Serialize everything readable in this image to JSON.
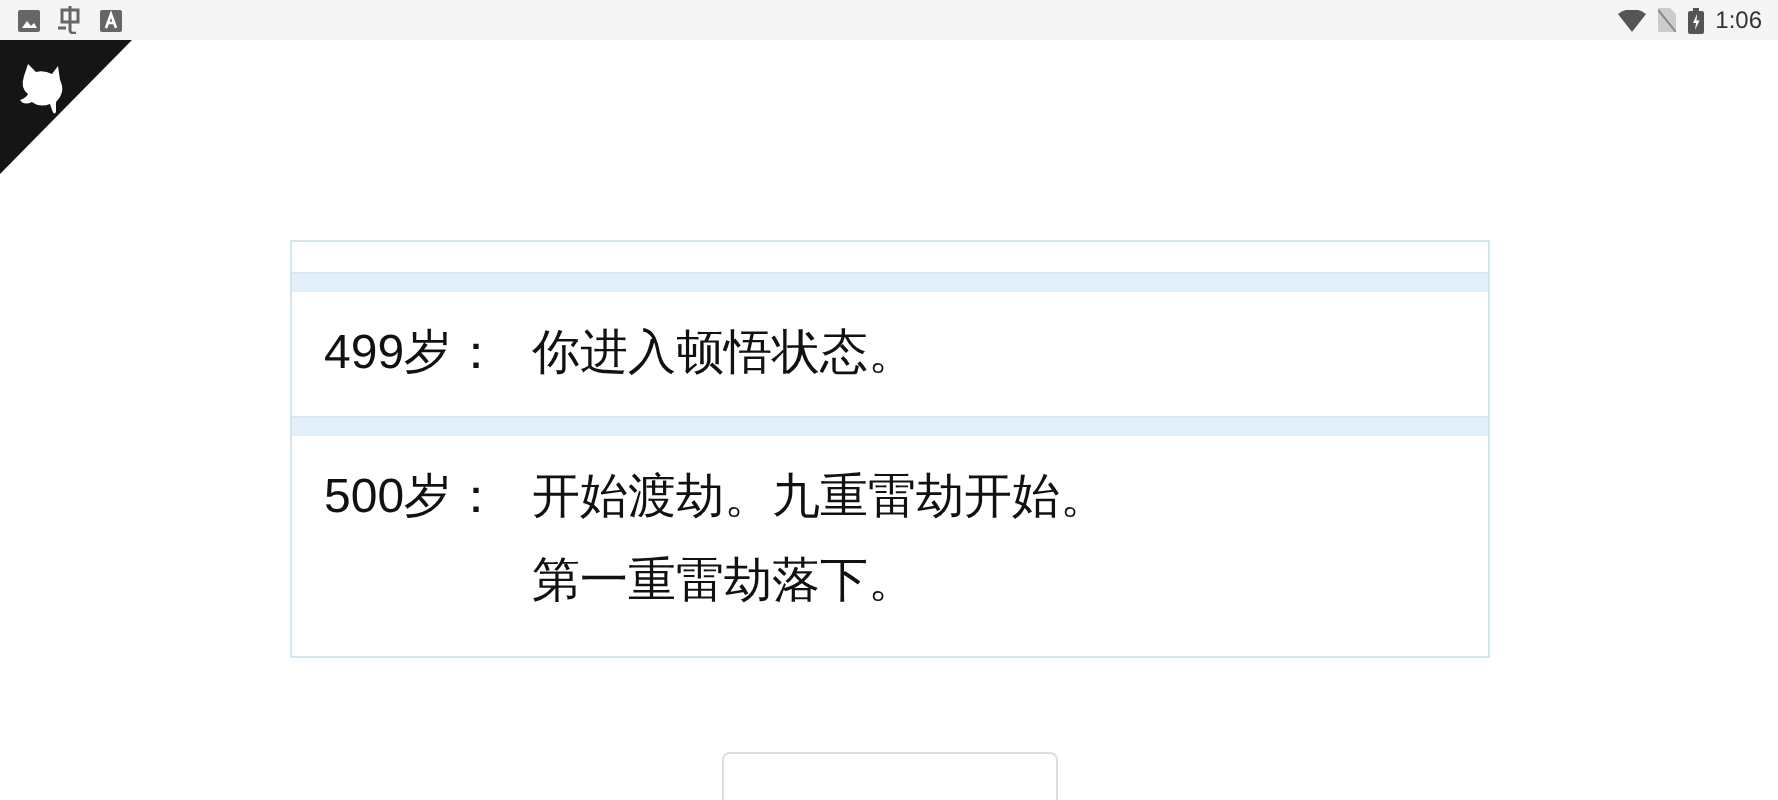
{
  "status_bar": {
    "time": "1:06"
  },
  "log": {
    "entries": [
      {
        "kind": "blank"
      },
      {
        "kind": "event",
        "age": "499岁：",
        "lines": [
          "你进入顿悟状态。"
        ]
      },
      {
        "kind": "event",
        "age": "500岁：",
        "lines": [
          "开始渡劫。九重雷劫开始。",
          "第一重雷劫落下。"
        ]
      }
    ]
  }
}
